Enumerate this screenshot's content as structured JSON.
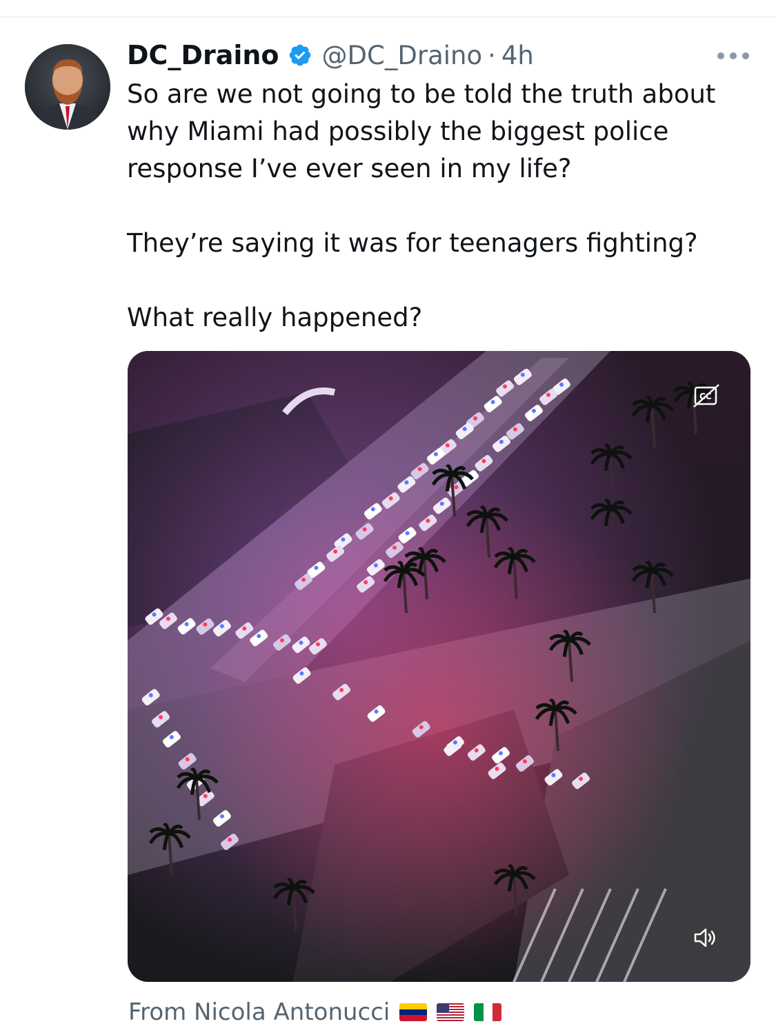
{
  "tweet": {
    "author": {
      "display_name": "DC_Draino",
      "handle": "@DC_Draino",
      "verified": true,
      "avatar_icon": "profile-photo"
    },
    "separator": "·",
    "time": "4h",
    "more_icon": "more-horizontal-icon",
    "text": [
      "So are we not going to be told the truth about",
      "why Miami had possibly the biggest police",
      "response I’ve ever seen in my life?",
      "They’re saying it was for teenagers fighting?",
      "What really happened?"
    ],
    "media": {
      "type": "video",
      "cc_icon": "captions-off-icon",
      "volume_icon": "volume-icon"
    },
    "attribution": {
      "prefix": "From Nicola Antonucci",
      "flags": [
        "venezuela-flag",
        "usa-flag",
        "italy-flag"
      ]
    }
  },
  "colors": {
    "verified_blue": "#1d9bf0",
    "secondary_text": "#536471",
    "primary_text": "#0f1419"
  }
}
